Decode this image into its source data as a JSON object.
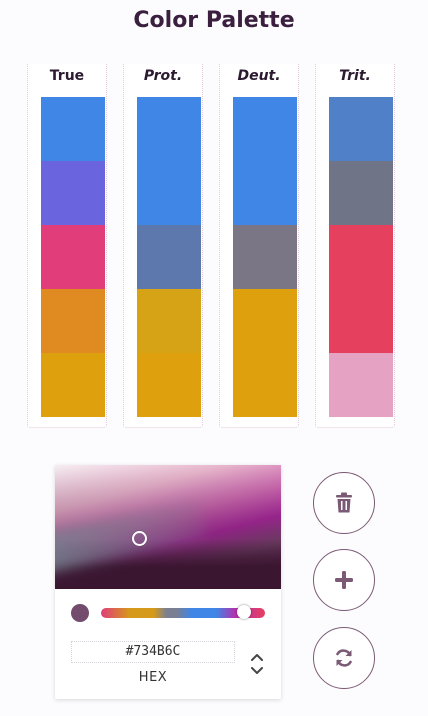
{
  "header": {
    "title": "Color Palette"
  },
  "columns": [
    {
      "label": "True",
      "italic": false,
      "swatches": [
        "#3f86e6",
        "#6b64df",
        "#e03d7a",
        "#e08a22",
        "#dfa00d"
      ]
    },
    {
      "label": "Prot.",
      "italic": true,
      "swatches": [
        "#3f86e6",
        "#3f86e6",
        "#5d78ad",
        "#d6a316",
        "#dfa00d"
      ]
    },
    {
      "label": "Deut.",
      "italic": true,
      "swatches": [
        "#3f86e6",
        "#3f86e6",
        "#7b7685",
        "#dfa00d",
        "#dfa00d"
      ]
    },
    {
      "label": "Trit.",
      "italic": true,
      "swatches": [
        "#4f80c8",
        "#707487",
        "#e6405f",
        "#e6405f",
        "#e6a2c2"
      ]
    }
  ],
  "picker": {
    "hex_value": "#734B6C",
    "format_label": "HEX",
    "current_color": "#734b6c",
    "hue_fraction": 0.87
  },
  "actions": {
    "delete_icon": "trash-icon",
    "add_icon": "plus-icon",
    "refresh_icon": "refresh-icon"
  }
}
